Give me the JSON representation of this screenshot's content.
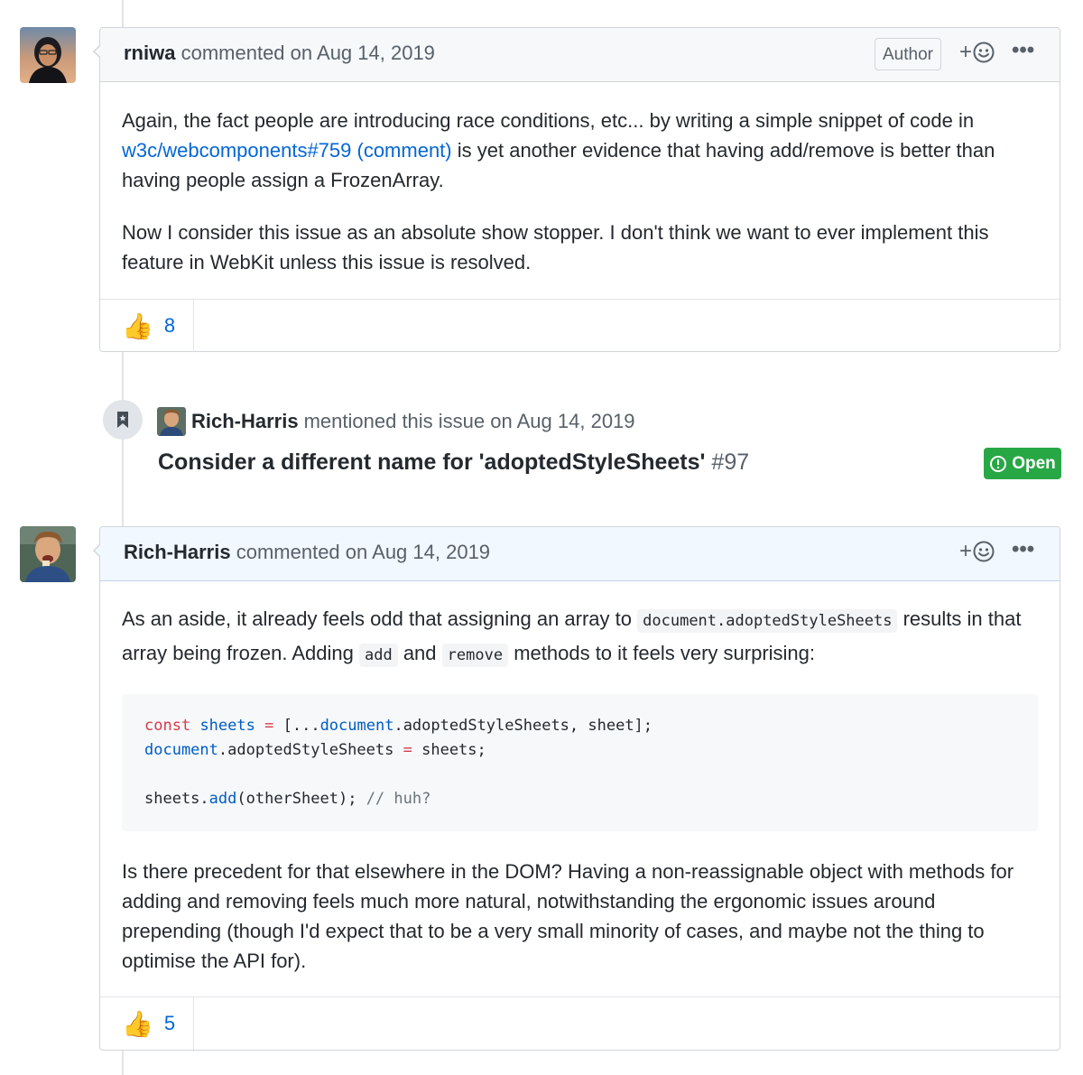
{
  "comment1": {
    "author": "rniwa",
    "meta": "commented on Aug 14, 2019",
    "badge": "Author",
    "react_plus": "+",
    "more": "•••",
    "p1_a": "Again, the fact people are introducing race conditions, etc... by writing a simple snippet of code in",
    "link": "w3c/webcomponents#759 (comment)",
    "p1_b": "is yet another evidence that having add/remove is better than having people assign a FrozenArray.",
    "p2": "Now I consider this issue as an absolute show stopper. I don't think we want to ever implement this feature in WebKit unless this issue is resolved.",
    "reaction_emoji": "👍",
    "reaction_count": "8"
  },
  "event": {
    "author": "Rich-Harris",
    "text": "mentioned this issue on Aug 14, 2019",
    "issue_title": "Consider a different name for 'adoptedStyleSheets'",
    "issue_number": "#97",
    "status": "Open"
  },
  "comment2": {
    "author": "Rich-Harris",
    "meta": "commented on Aug 14, 2019",
    "react_plus": "+",
    "more": "•••",
    "p1_a": "As an aside, it already feels odd that assigning an array to",
    "code1": "document.adoptedStyleSheets",
    "p1_b": "results in that array being frozen. Adding",
    "code2": "add",
    "p1_c": "and",
    "code3": "remove",
    "p1_d": "methods to it feels very surprising:",
    "code_lines": {
      "l1_kw": "const",
      "l1_var": "sheets",
      "l1_eq": "=",
      "l1_spread": "[...",
      "l1_doc": "document",
      "l1_rest": ".adoptedStyleSheets, sheet];",
      "l2_doc": "document",
      "l2_mid": ".adoptedStyleSheets",
      "l2_eq": "=",
      "l2_rest": "sheets;",
      "l3_obj": "sheets.",
      "l3_fn": "add",
      "l3_rest": "(otherSheet);",
      "l3_comment": "// huh?"
    },
    "p2": "Is there precedent for that elsewhere in the DOM? Having a non-reassignable object with methods for adding and removing feels much more natural, notwithstanding the ergonomic issues around prepending (though I'd expect that to be a very small minority of cases, and maybe not the thing to optimise the API for).",
    "reaction_emoji": "👍",
    "reaction_count": "5"
  }
}
